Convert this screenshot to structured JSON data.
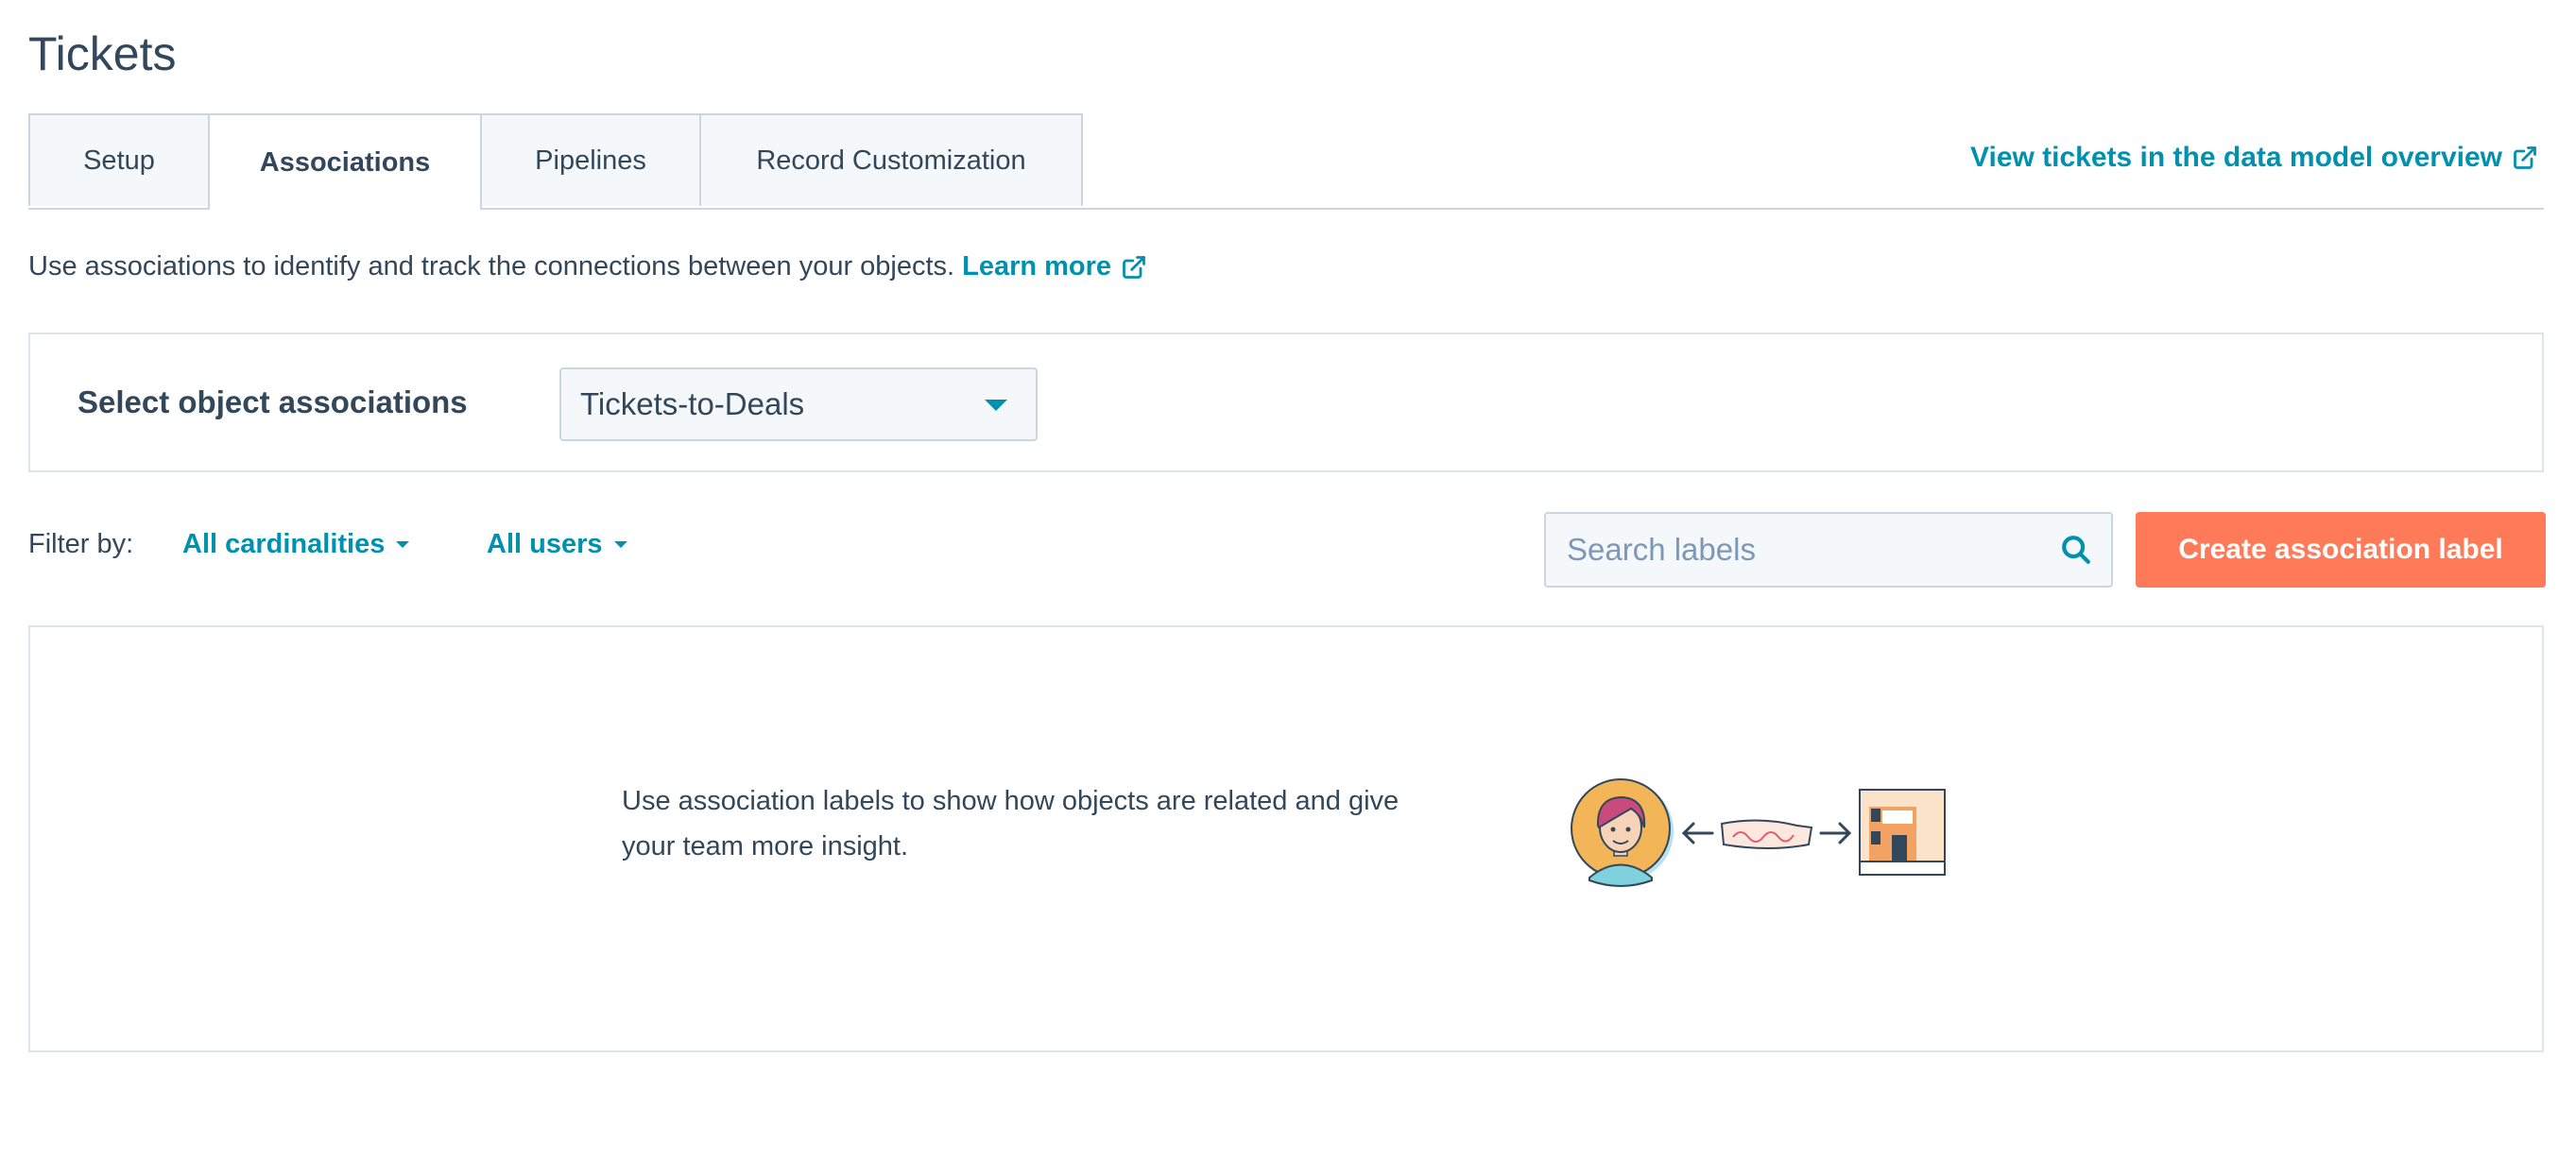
{
  "page": {
    "title": "Tickets"
  },
  "tabs": [
    {
      "label": "Setup"
    },
    {
      "label": "Associations"
    },
    {
      "label": "Pipelines"
    },
    {
      "label": "Record Customization"
    }
  ],
  "data_model_link": {
    "label": "View tickets in the data model overview",
    "icon": "external-link-icon"
  },
  "intro": {
    "text": "Use associations to identify and track the connections between your objects.",
    "link_label": "Learn more"
  },
  "associations": {
    "label": "Select object associations",
    "selected": "Tickets-to-Deals"
  },
  "filters": {
    "label": "Filter by:",
    "cardinality": "All cardinalities",
    "users": "All users"
  },
  "search": {
    "placeholder": "Search labels",
    "value": ""
  },
  "create_button": {
    "label": "Create association label"
  },
  "empty_state": {
    "text": "Use association labels to show how objects are related and give your team more insight."
  },
  "colors": {
    "accent": "#0091ae",
    "primary_button": "#ff7a59",
    "text": "#33475b",
    "border": "#cbd6e2",
    "panel_bg": "#f5f8fa"
  }
}
